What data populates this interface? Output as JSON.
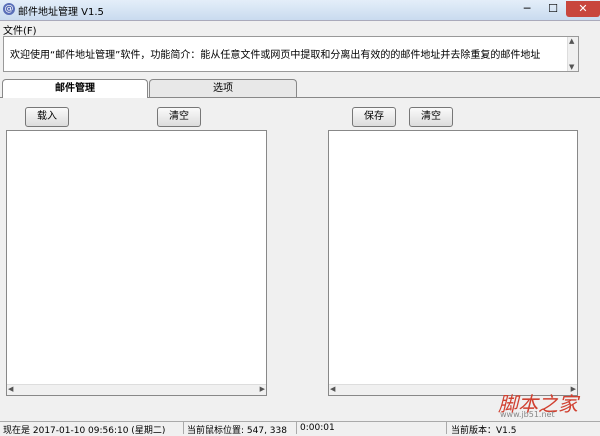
{
  "window": {
    "title": "邮件地址管理 V1.5",
    "min_glyph": "─",
    "max_glyph": "☐",
    "close_glyph": "✕",
    "icon_glyph": "@"
  },
  "menu": {
    "file": "文件(F)"
  },
  "info": {
    "text": "欢迎使用“邮件地址管理”软件，功能简介：能从任意文件或网页中提取和分离出有效的的邮件地址并去除重复的邮件地址"
  },
  "tabs": [
    {
      "label": "邮件管理"
    },
    {
      "label": "选项"
    }
  ],
  "buttons": {
    "load": "载入",
    "clear_left": "清空",
    "save": "保存",
    "clear_right": "清空"
  },
  "status": {
    "time": "现在是 2017-01-10 09:56:10 (星期二)",
    "mouse": "当前鼠标位置: 547, 338",
    "elapsed": "0:00:01",
    "version": "当前版本：V1.5"
  },
  "watermark": {
    "logo": "脚本之家",
    "url": "www.jb51.net"
  }
}
